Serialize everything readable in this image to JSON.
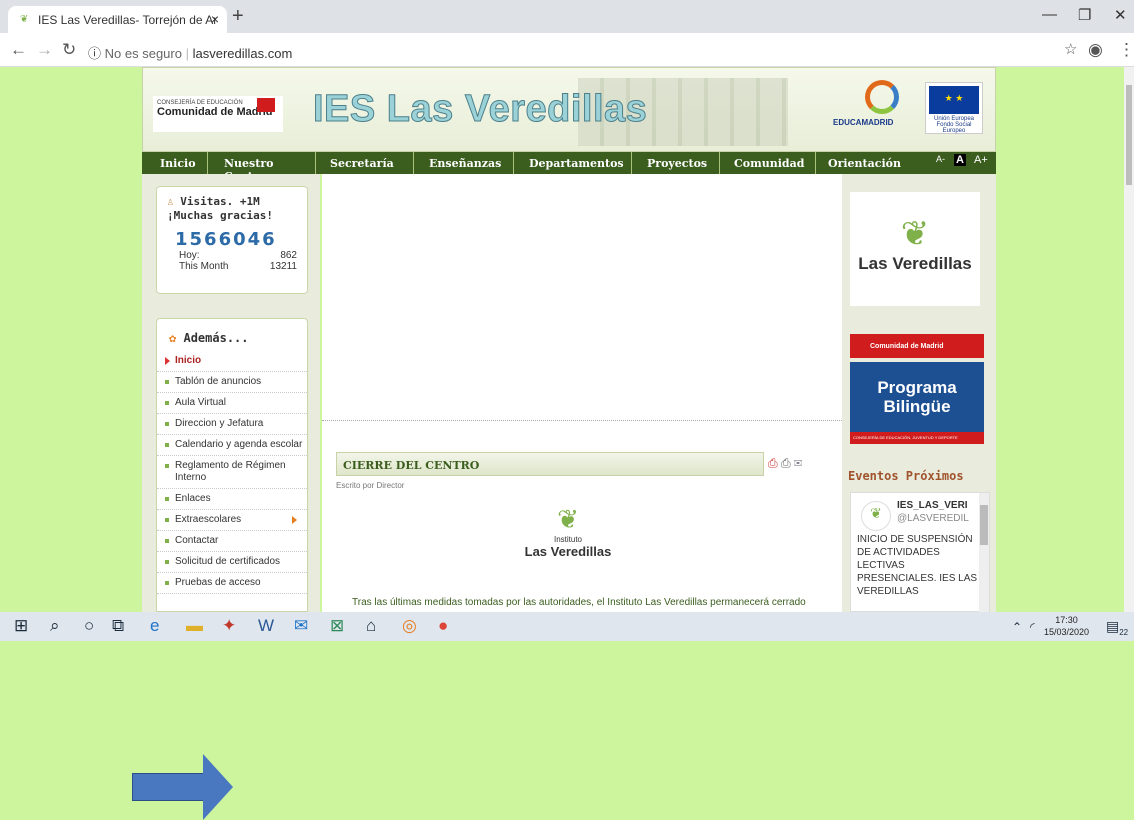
{
  "browser": {
    "tab_title": "IES Las Veredillas- Torrejón de Ar",
    "url_prefix": "No es seguro",
    "url": "lasveredillas.com"
  },
  "banner": {
    "consejeria": "CONSEJERÍA DE EDUCACIÓN",
    "comunidad": "Comunidad de Madrid",
    "title": "IES Las Veredillas",
    "educamadrid": "EDUCAMADRID",
    "eu": "Unión Europea",
    "eu_sub": "Fondo Social Europeo"
  },
  "menu": [
    "Inicio",
    "Nuestro Centro",
    "Secretaría",
    "Enseñanzas",
    "Departamentos",
    "Proyectos",
    "Comunidad",
    "Orientación"
  ],
  "font_controls": [
    "A-",
    "A",
    "A+"
  ],
  "visits": {
    "heading": "Visitas. +1M ¡Muchas gracias!",
    "total": "1566046",
    "today_label": "Hoy:",
    "today_value": "862",
    "month_label": "This Month",
    "month_value": "13211"
  },
  "ademas": {
    "heading": "Además...",
    "items": [
      "Inicio",
      "Tablón de anuncios",
      "Aula Virtual",
      "Direccion y Jefatura",
      "Calendario y agenda escolar",
      "Reglamento de Régimen Interno",
      "Enlaces",
      "Extraescolares",
      "Contactar",
      "Solicitud de certificados",
      "Pruebas de acceso"
    ]
  },
  "article": {
    "title": "CIERRE DEL CENTRO",
    "author": "Escrito por Director",
    "logo_small": "Instituto",
    "logo_big": "Las Veredillas",
    "text": "Tras las últimas medidas tomadas por las autoridades, el Instituto Las Veredillas permanecerá cerrado"
  },
  "sidebar": {
    "card_name": "Las Veredillas",
    "cm_banner": "Comunidad de Madrid",
    "programa": "Programa Bilingüe",
    "programa_sub": "CONSEJERÍA DE EDUCACIÓN, JUVENTUD Y DEPORTE",
    "eventos": "Eventos Próximos",
    "tweet_name": "IES_LAS_VERI",
    "tweet_handle": "@LASVEREDIL",
    "tweet_text": "INICIO DE SUSPENSIÓN DE ACTIVIDADES LECTIVAS PRESENCIALES. IES LAS VEREDILLAS"
  },
  "taskbar": {
    "time": "17:30",
    "date": "15/03/2020",
    "notif": "22"
  },
  "colors": {
    "page_bg": "#ccf59e",
    "menu_bg": "#3b5d1e",
    "arrow": "#4a78c0"
  }
}
